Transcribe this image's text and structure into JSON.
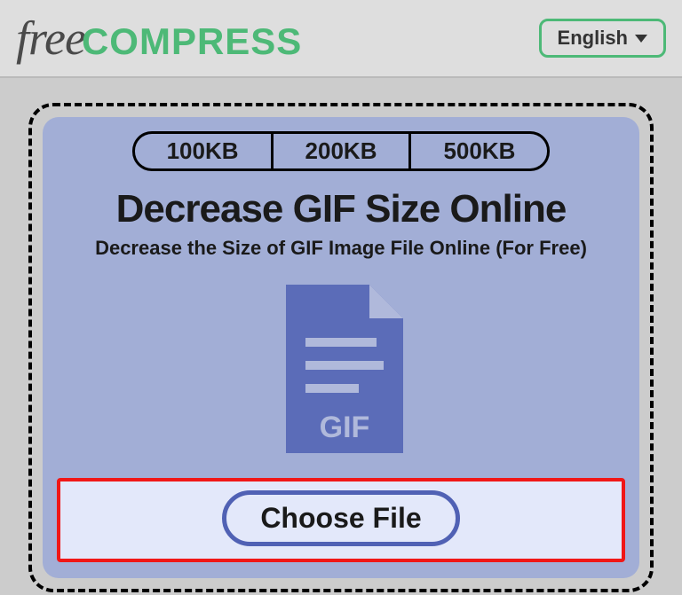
{
  "header": {
    "logo_free": "free",
    "logo_compress": "COMPRESS",
    "language_label": "English"
  },
  "sizes": {
    "opt1": "100KB",
    "opt2": "200KB",
    "opt3": "500KB"
  },
  "main": {
    "title": "Decrease GIF Size Online",
    "subtitle": "Decrease the Size of GIF Image File Online (For Free)",
    "file_type_label": "GIF",
    "choose_file_label": "Choose File"
  },
  "colors": {
    "accent_green": "#4db977",
    "panel_blue": "#a2aed6",
    "icon_blue": "#5b6cb8",
    "highlight_red": "#f01717"
  }
}
